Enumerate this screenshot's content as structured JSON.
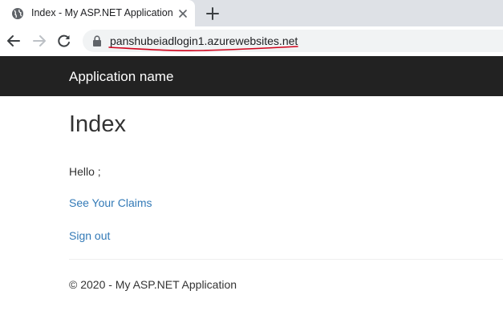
{
  "browser": {
    "tab": {
      "title": "Index - My ASP.NET Application"
    },
    "address_bar": {
      "url": "panshubeiadlogin1.azurewebsites.net"
    }
  },
  "navbar": {
    "brand": "Application name"
  },
  "main": {
    "heading": "Index",
    "greeting": "Hello ;",
    "links": {
      "claims": "See Your Claims",
      "signout": "Sign out"
    }
  },
  "footer": {
    "text": "© 2020 - My ASP.NET Application"
  },
  "colors": {
    "navbar_bg": "#222222",
    "link": "#337ab7",
    "annotation_underline": "#d0021b"
  }
}
